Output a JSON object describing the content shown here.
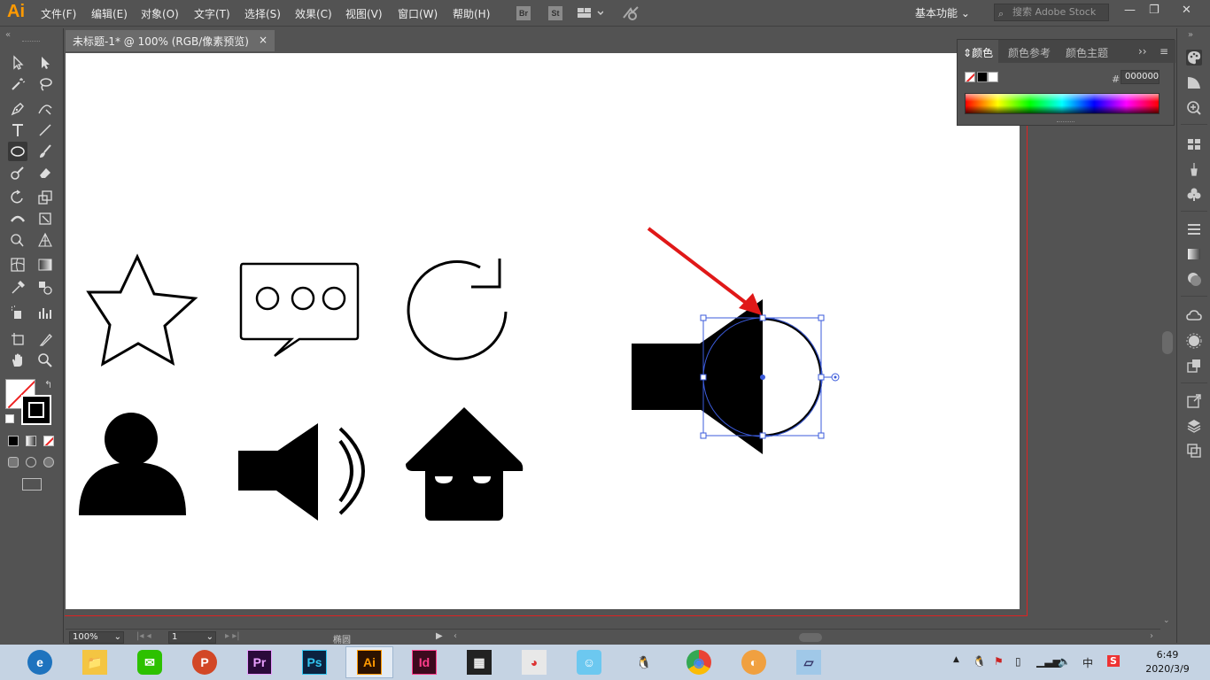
{
  "app": {
    "logo": "Ai"
  },
  "menubar": {
    "items": [
      "文件(F)",
      "编辑(E)",
      "对象(O)",
      "文字(T)",
      "选择(S)",
      "效果(C)",
      "视图(V)",
      "窗口(W)",
      "帮助(H)"
    ],
    "bridge_label": "Br",
    "stock_label": "St",
    "workspace_label": "基本功能",
    "search_placeholder": "搜索 Adobe Stock",
    "minimize": "—",
    "restore": "❐",
    "close": "✕"
  },
  "document": {
    "tab_title": "未标题-1* @ 100% (RGB/像素预览)",
    "close_glyph": "×"
  },
  "color_panel": {
    "tabs": [
      "颜色",
      "颜色参考",
      "颜色主题"
    ],
    "active_tab": "颜色",
    "hex_label": "#",
    "hex_value": "000000",
    "expand_glyph": "››",
    "menu_glyph": "≡"
  },
  "statusbar": {
    "zoom": "100%",
    "page": "1",
    "tool_type": "椭圆"
  },
  "taskbar": {
    "apps": [
      {
        "name": "edge",
        "label": "e",
        "bg": "#1e73be"
      },
      {
        "name": "explorer",
        "label": "📁",
        "bg": "#f4c542"
      },
      {
        "name": "wechat",
        "label": "✉",
        "bg": "#2dc100"
      },
      {
        "name": "powerpoint",
        "label": "P",
        "bg": "#d24726"
      },
      {
        "name": "premiere",
        "label": "Pr",
        "bg": "#2a0a3a"
      },
      {
        "name": "photoshop",
        "label": "Ps",
        "bg": "#0c2340"
      },
      {
        "name": "illustrator",
        "label": "Ai",
        "bg": "#2c1200"
      },
      {
        "name": "indesign",
        "label": "Id",
        "bg": "#3d0a1e"
      },
      {
        "name": "video",
        "label": "▦",
        "bg": "#222"
      },
      {
        "name": "tool1",
        "label": "◕",
        "bg": "#e8e8e8"
      },
      {
        "name": "tool2",
        "label": "☺",
        "bg": "#6cc8f0"
      },
      {
        "name": "qq",
        "label": "🐧",
        "bg": "#c5d3e3"
      },
      {
        "name": "chrome",
        "label": "◉",
        "bg": "#4285f4"
      },
      {
        "name": "tool3",
        "label": "◐",
        "bg": "#f0a040"
      },
      {
        "name": "tool4",
        "label": "▱",
        "bg": "#a0c8e8"
      }
    ],
    "active_app": "illustrator",
    "tray_ime": "中",
    "tray_s": "S",
    "time": "6:49",
    "date": "2020/3/9"
  }
}
